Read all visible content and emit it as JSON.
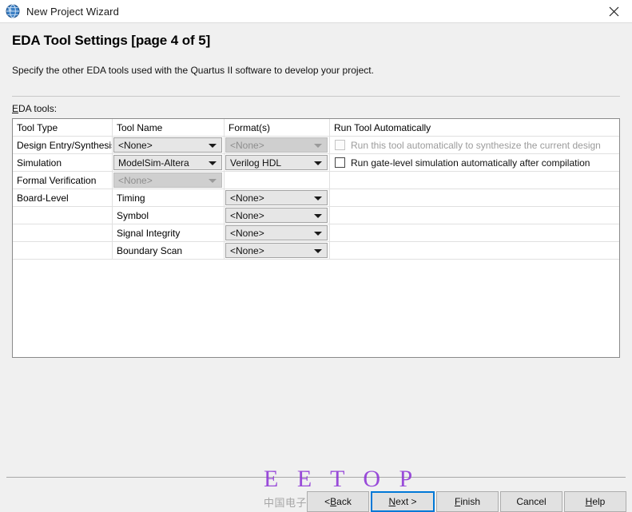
{
  "window": {
    "title": "New Project Wizard",
    "icon": "quartus-globe-icon",
    "close_label": "close-icon"
  },
  "header": {
    "title": "EDA Tool Settings [page 4 of 5]",
    "subtitle": "Specify the other EDA tools used with the Quartus II software to develop your project.",
    "field_label_accel": "E",
    "field_label_rest": "DA tools:"
  },
  "table": {
    "columns": [
      "Tool Type",
      "Tool Name",
      "Format(s)",
      "Run Tool Automatically"
    ],
    "rows": [
      {
        "tool_type": "Design Entry/Synthesis",
        "tool_name": {
          "value": "<None>",
          "disabled": false
        },
        "format": {
          "value": "<None>",
          "disabled": true
        },
        "run": {
          "label": "Run this tool automatically to synthesize the current design",
          "checked": false,
          "disabled": true
        }
      },
      {
        "tool_type": "Simulation",
        "tool_name": {
          "value": "ModelSim-Altera",
          "disabled": false
        },
        "format": {
          "value": "Verilog HDL",
          "disabled": false
        },
        "run": {
          "label": "Run gate-level simulation automatically after compilation",
          "checked": false,
          "disabled": false
        }
      },
      {
        "tool_type": "Formal Verification",
        "tool_name": {
          "value": "<None>",
          "disabled": true
        },
        "format": null,
        "run": null
      },
      {
        "tool_type": "Board-Level",
        "tool_name": {
          "value": "Timing",
          "plain": true
        },
        "format": {
          "value": "<None>",
          "disabled": false
        },
        "run": null
      },
      {
        "tool_type": "",
        "tool_name": {
          "value": "Symbol",
          "plain": true
        },
        "format": {
          "value": "<None>",
          "disabled": false
        },
        "run": null
      },
      {
        "tool_type": "",
        "tool_name": {
          "value": "Signal Integrity",
          "plain": true
        },
        "format": {
          "value": "<None>",
          "disabled": false
        },
        "run": null
      },
      {
        "tool_type": "",
        "tool_name": {
          "value": "Boundary Scan",
          "plain": true
        },
        "format": {
          "value": "<None>",
          "disabled": false
        },
        "run": null
      }
    ]
  },
  "buttons": {
    "back": {
      "accel": "B",
      "pre": "< ",
      "post": "ack"
    },
    "next": {
      "accel": "N",
      "pre": "",
      "post": "ext >"
    },
    "finish": {
      "accel": "F",
      "pre": "",
      "post": "inish"
    },
    "cancel": {
      "accel": "",
      "pre": "Cancel",
      "post": ""
    },
    "help": {
      "accel": "H",
      "pre": "",
      "post": "elp"
    }
  },
  "watermark": {
    "main": "E E T O P",
    "sub": "中国电子顶级开发网",
    "color": "#8b2fd6"
  },
  "colors": {
    "accent": "#0078d7",
    "page_bg": "#f0f0f0",
    "table_bg": "#ffffff",
    "combo_bg": "#e6e6e6",
    "combo_disabled_bg": "#cfcfcf"
  }
}
